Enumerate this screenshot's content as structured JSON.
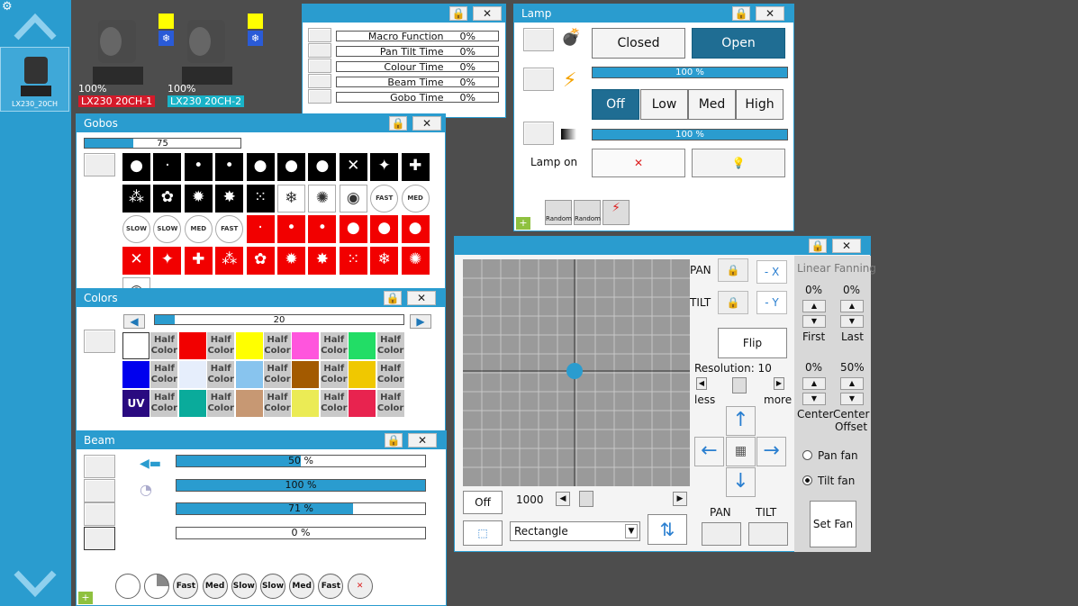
{
  "sidebar": {
    "device_label": "LX230_20CH"
  },
  "fixtures": [
    {
      "pct": "100%",
      "label": "LX230 20CH-1",
      "label_color": "#d51a2a"
    },
    {
      "pct": "100%",
      "label": "LX230 20CH-2",
      "label_color": "#19b3c8"
    }
  ],
  "macro": {
    "rows": [
      {
        "name": "Macro Function",
        "value": "0%"
      },
      {
        "name": "Pan Tilt Time",
        "value": "0%"
      },
      {
        "name": "Colour Time",
        "value": "0%"
      },
      {
        "name": "Beam Time",
        "value": "0%"
      },
      {
        "name": "Gobo Time",
        "value": "0%"
      }
    ]
  },
  "lamp": {
    "title": "Lamp",
    "closed": "Closed",
    "open": "Open",
    "bar1": "100 %",
    "bar1_level": 1.0,
    "modes": [
      "Off",
      "Low",
      "Med",
      "High"
    ],
    "bar2": "100 %",
    "bar2_level": 1.0,
    "lamp_on": "Lamp on",
    "random_labels": [
      "Random",
      "Random"
    ]
  },
  "gobos": {
    "title": "Gobos",
    "slider": "75",
    "slider_level": 0.31,
    "speed_labels": [
      "FAST",
      "MED",
      "SLOW",
      "SLOW",
      "MED",
      "FAST"
    ]
  },
  "colors": {
    "title": "Colors",
    "slider": "20",
    "slider_level": 0.08,
    "half": "Half",
    "color": "Color",
    "uv": "UV"
  },
  "beam": {
    "title": "Beam",
    "bars": [
      {
        "label": "50 %",
        "level": 0.5
      },
      {
        "label": "100 %",
        "level": 1.0
      },
      {
        "label": "71 %",
        "level": 0.71
      },
      {
        "label": "0 %",
        "level": 0.0
      }
    ],
    "shutter_labels": [
      "Fast",
      "Med",
      "Slow",
      "Slow",
      "Med",
      "Fast"
    ]
  },
  "pantilt": {
    "pan": "PAN",
    "tilt": "TILT",
    "neg_x": "- X",
    "neg_y": "- Y",
    "flip": "Flip",
    "resolution": "Resolution: 10",
    "less": "less",
    "more": "more",
    "off": "Off",
    "speed_value": "1000",
    "shape": "Rectangle",
    "pan_bottom": "PAN",
    "tilt_bottom": "TILT",
    "fanning_title": "Linear Fanning",
    "first_pct": "0%",
    "last_pct": "0%",
    "first": "First",
    "last": "Last",
    "center_pct": "0%",
    "offset_pct": "50%",
    "center": "Center",
    "center_offset": "Center Offset",
    "pan_fan": "Pan fan",
    "tilt_fan": "Tilt fan",
    "set_fan": "Set Fan"
  }
}
